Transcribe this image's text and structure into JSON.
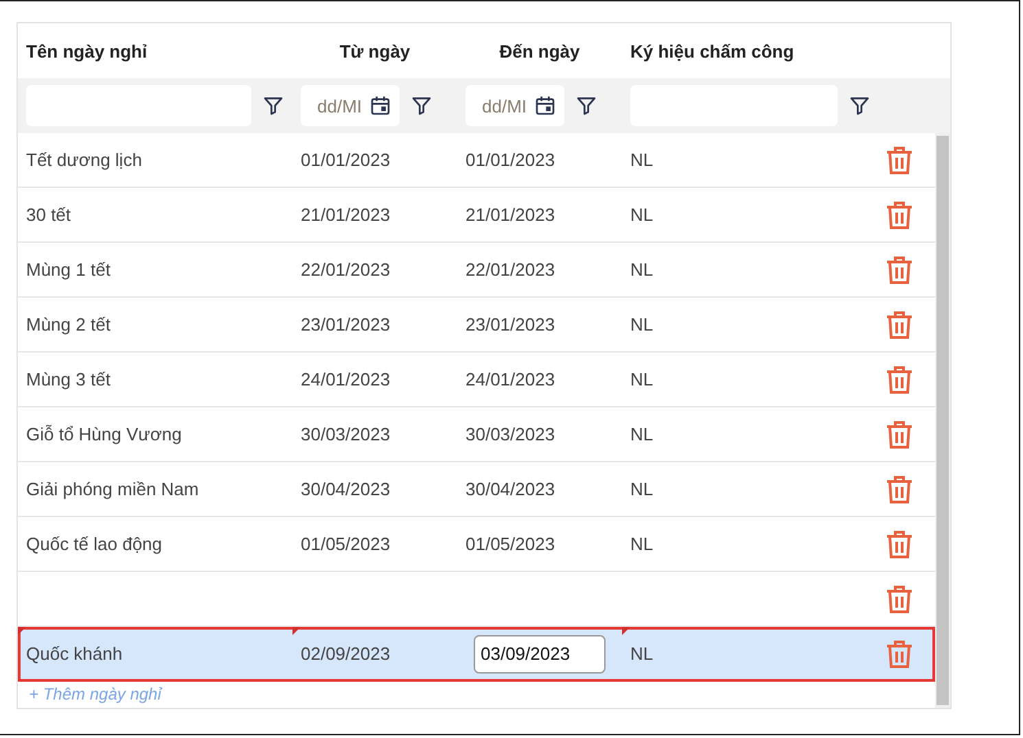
{
  "columns": [
    {
      "label": "Tên ngày nghỉ"
    },
    {
      "label": "Từ ngày"
    },
    {
      "label": "Đến ngày"
    },
    {
      "label": "Ký hiệu chấm công"
    }
  ],
  "filters": [
    {
      "kind": "text"
    },
    {
      "kind": "date",
      "placeholder": "dd/MI"
    },
    {
      "kind": "date",
      "placeholder": "dd/MI"
    },
    {
      "kind": "text"
    }
  ],
  "rows": [
    {
      "name": "Tết dương lịch",
      "from": "01/01/2023",
      "to": "01/01/2023",
      "code": "NL",
      "selected": false,
      "editing": false,
      "modified": false
    },
    {
      "name": "30 tết",
      "from": "21/01/2023",
      "to": "21/01/2023",
      "code": "NL",
      "selected": false,
      "editing": false,
      "modified": false
    },
    {
      "name": "Mùng 1 tết",
      "from": "22/01/2023",
      "to": "22/01/2023",
      "code": "NL",
      "selected": false,
      "editing": false,
      "modified": false
    },
    {
      "name": "Mùng 2 tết",
      "from": "23/01/2023",
      "to": "23/01/2023",
      "code": "NL",
      "selected": false,
      "editing": false,
      "modified": false
    },
    {
      "name": "Mùng 3 tết",
      "from": "24/01/2023",
      "to": "24/01/2023",
      "code": "NL",
      "selected": false,
      "editing": false,
      "modified": false
    },
    {
      "name": "Giỗ tổ Hùng Vương",
      "from": "30/03/2023",
      "to": "30/03/2023",
      "code": "NL",
      "selected": false,
      "editing": false,
      "modified": false
    },
    {
      "name": "Giải phóng miền Nam",
      "from": "30/04/2023",
      "to": "30/04/2023",
      "code": "NL",
      "selected": false,
      "editing": false,
      "modified": false
    },
    {
      "name": "Quốc tế lao động",
      "from": "01/05/2023",
      "to": "01/05/2023",
      "code": "NL",
      "selected": false,
      "editing": false,
      "modified": false
    },
    {
      "selected": false,
      "editing": false,
      "modified": false
    },
    {
      "name": "Quốc khánh",
      "from": "02/09/2023",
      "to": "03/09/2023",
      "code": "NL",
      "selected": true,
      "editing": true,
      "modified": true
    }
  ],
  "add_link": "+ Thêm ngày nghỉ"
}
